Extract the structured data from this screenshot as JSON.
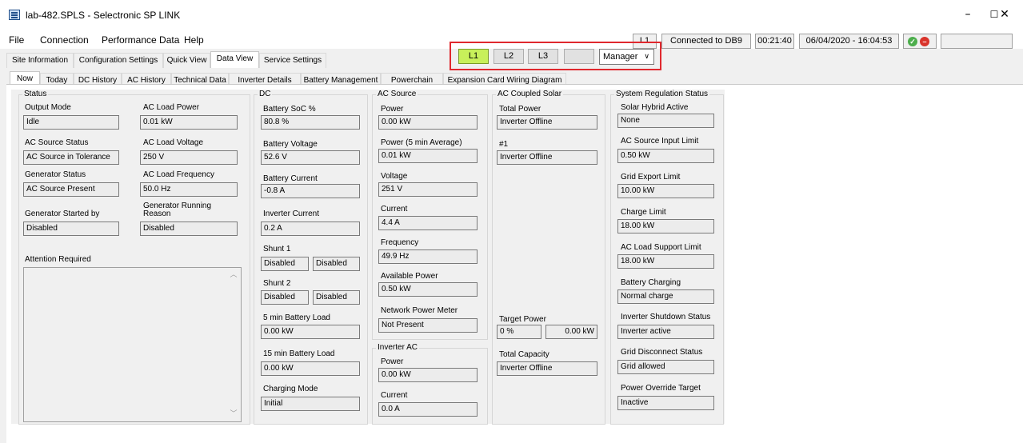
{
  "window": {
    "title": "lab-482.SPLS - Selectronic SP LINK",
    "minimize": "–",
    "maximize": "☐",
    "close": "✕"
  },
  "menu": [
    "File",
    "Connection",
    "Performance Data",
    "Help"
  ],
  "status": {
    "phase": "L1",
    "connection": "Connected to DB9",
    "elapsed": "00:21:40",
    "datetime": "06/04/2020 - 16:04:53"
  },
  "main_tabs": [
    "Site Information",
    "Configuration Settings",
    "Quick View",
    "Data View",
    "Service Settings"
  ],
  "phases": [
    "L1",
    "L2",
    "L3"
  ],
  "user_level": "Manager",
  "sub_tabs": [
    "Now",
    "Today",
    "DC History",
    "AC History",
    "Technical Data",
    "Inverter Details",
    "Battery Management",
    "Powerchain",
    "Expansion Card Wiring Diagram"
  ],
  "groups": {
    "status": {
      "title": "Status",
      "output_mode": {
        "label": "Output Mode",
        "value": "Idle"
      },
      "ac_load_power": {
        "label": "AC Load Power",
        "value": "0.01 kW"
      },
      "ac_source_status": {
        "label": "AC Source Status",
        "value": "AC Source in Tolerance"
      },
      "ac_load_voltage": {
        "label": "AC Load Voltage",
        "value": "250 V"
      },
      "generator_status": {
        "label": "Generator Status",
        "value": "AC Source Present"
      },
      "ac_load_frequency": {
        "label": "AC Load Frequency",
        "value": "50.0 Hz"
      },
      "generator_started_by": {
        "label": "Generator Started by",
        "value": "Disabled"
      },
      "generator_running_reason": {
        "label_1": "Generator Running",
        "label_2": "Reason",
        "value": "Disabled"
      },
      "attention": {
        "label": "Attention Required"
      }
    },
    "dc": {
      "title": "DC",
      "battery_soc": {
        "label": "Battery SoC %",
        "value": "80.8 %"
      },
      "battery_voltage": {
        "label": "Battery Voltage",
        "value": "52.6 V"
      },
      "battery_current": {
        "label": "Battery Current",
        "value": "-0.8 A"
      },
      "inverter_current": {
        "label": "Inverter Current",
        "value": "0.2 A"
      },
      "shunt1": {
        "label": "Shunt 1",
        "value_a": "Disabled",
        "value_b": "Disabled"
      },
      "shunt2": {
        "label": "Shunt 2",
        "value_a": "Disabled",
        "value_b": "Disabled"
      },
      "battery_load_5": {
        "label": "5 min Battery Load",
        "value": "0.00 kW"
      },
      "battery_load_15": {
        "label": "15 min Battery Load",
        "value": "0.00 kW"
      },
      "charging_mode": {
        "label": "Charging Mode",
        "value": "Initial"
      }
    },
    "ac_source": {
      "title": "AC Source",
      "power": {
        "label": "Power",
        "value": "0.00 kW"
      },
      "power_avg": {
        "label": "Power (5 min Average)",
        "value": "0.01 kW"
      },
      "voltage": {
        "label": "Voltage",
        "value": "251 V"
      },
      "current": {
        "label": "Current",
        "value": "4.4 A"
      },
      "frequency": {
        "label": "Frequency",
        "value": "49.9 Hz"
      },
      "available_power": {
        "label": "Available Power",
        "value": "0.50 kW"
      },
      "network_meter": {
        "label": "Network Power Meter",
        "value": "Not Present"
      }
    },
    "inverter_ac": {
      "title": "Inverter AC",
      "power": {
        "label": "Power",
        "value": "0.00 kW"
      },
      "current": {
        "label": "Current",
        "value": "0.0 A"
      }
    },
    "ac_coupled_solar": {
      "title": "AC Coupled Solar",
      "total_power": {
        "label": "Total Power",
        "value": "Inverter Offline"
      },
      "unit1": {
        "label": "#1",
        "value": "Inverter Offline"
      },
      "target_power": {
        "label": "Target Power",
        "value_pct": "0 %",
        "value_kw": "0.00 kW"
      },
      "total_capacity": {
        "label": "Total Capacity",
        "value": "Inverter Offline"
      }
    },
    "system_regulation": {
      "title": "System Regulation Status",
      "solar_hybrid": {
        "label": "Solar Hybrid Active",
        "value": "None"
      },
      "ac_source_input_limit": {
        "label": "AC Source Input Limit",
        "value": "0.50 kW"
      },
      "grid_export_limit": {
        "label": "Grid Export Limit",
        "value": "10.00 kW"
      },
      "charge_limit": {
        "label": "Charge Limit",
        "value": "18.00 kW"
      },
      "ac_load_support_limit": {
        "label": "AC Load Support Limit",
        "value": "18.00 kW"
      },
      "battery_charging": {
        "label": "Battery Charging",
        "value": "Normal charge"
      },
      "inverter_shutdown": {
        "label": "Inverter Shutdown Status",
        "value": "Inverter active"
      },
      "grid_disconnect": {
        "label": "Grid Disconnect Status",
        "value": "Grid allowed"
      },
      "power_override": {
        "label": "Power Override Target",
        "value": "Inactive"
      }
    }
  }
}
